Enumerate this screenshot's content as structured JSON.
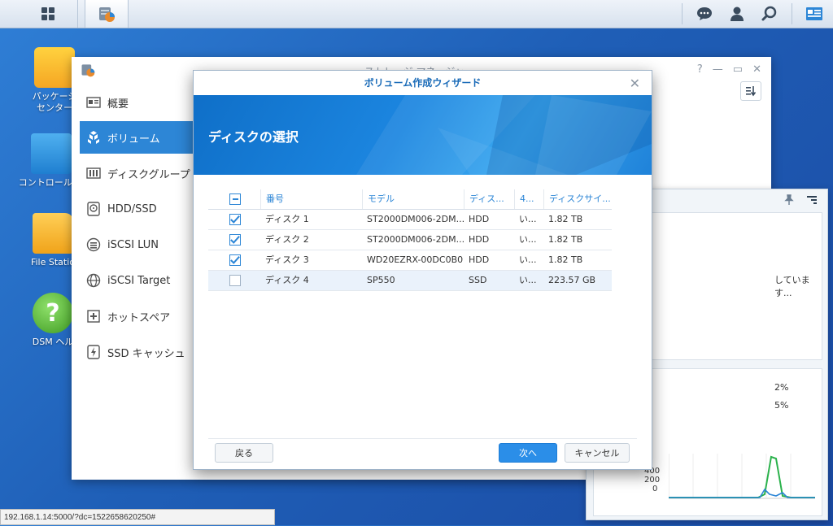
{
  "desktop": {
    "icons": [
      {
        "label": "パッケージ\nセンター"
      },
      {
        "label": "コントロール パ"
      },
      {
        "label": "File Statio"
      },
      {
        "label": "DSM ヘル"
      }
    ]
  },
  "storage_manager": {
    "title": "ストレージ マネージャ",
    "nav": [
      {
        "label": "概要"
      },
      {
        "label": "ボリューム"
      },
      {
        "label": "ディスクグループ"
      },
      {
        "label": "HDD/SSD"
      },
      {
        "label": "iSCSI LUN"
      },
      {
        "label": "iSCSI Target"
      },
      {
        "label": "ホットスペア"
      },
      {
        "label": "SSD キャッシュ"
      }
    ]
  },
  "widget": {
    "text1": "しています...",
    "pct1": "2%",
    "pct2": "5%",
    "ticks": [
      "400",
      "200",
      "0"
    ]
  },
  "wizard": {
    "title": "ボリューム作成ウィザード",
    "heading": "ディスクの選択",
    "columns": [
      "番号",
      "モデル",
      "ディス...",
      "4...",
      "ディスクサイ..."
    ],
    "rows": [
      {
        "num": "ディスク 1",
        "model": "ST2000DM006-2DM...",
        "type": "HDD",
        "c4": "い...",
        "size": "1.82 TB",
        "checked": true
      },
      {
        "num": "ディスク 2",
        "model": "ST2000DM006-2DM...",
        "type": "HDD",
        "c4": "い...",
        "size": "1.82 TB",
        "checked": true
      },
      {
        "num": "ディスク 3",
        "model": "WD20EZRX-00DC0B0",
        "type": "HDD",
        "c4": "い...",
        "size": "1.82 TB",
        "checked": true
      },
      {
        "num": "ディスク 4",
        "model": "SP550",
        "type": "SSD",
        "c4": "い...",
        "size": "223.57 GB",
        "checked": false
      }
    ],
    "buttons": {
      "back": "戻る",
      "next": "次へ",
      "cancel": "キャンセル"
    }
  },
  "statusbar": {
    "url": "192.168.1.14:5000/?dc=1522658620250#"
  },
  "colors": {
    "accent": "#2d86d6",
    "desktop": "#1f5fb7"
  }
}
